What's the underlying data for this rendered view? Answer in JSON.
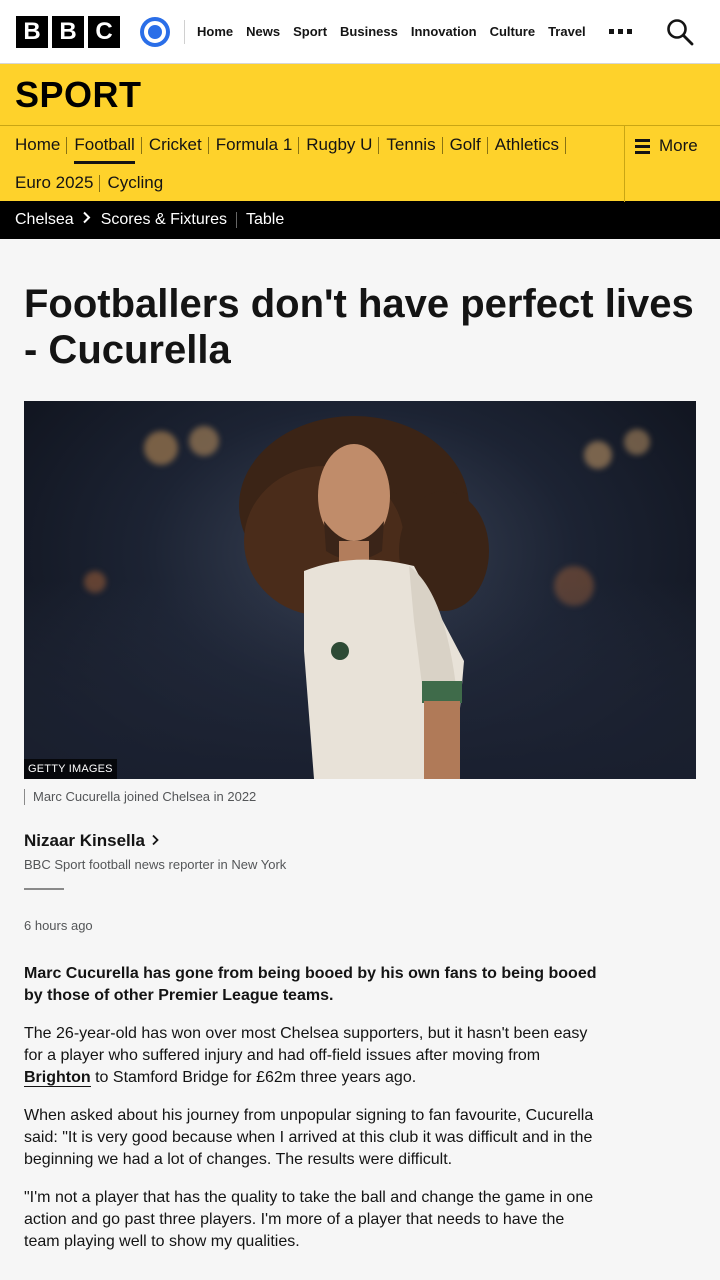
{
  "brand": {
    "letters": [
      "B",
      "B",
      "C"
    ]
  },
  "topnav": [
    "Home",
    "News",
    "Sport",
    "Business",
    "Innovation",
    "Culture",
    "Travel"
  ],
  "section": {
    "title": "SPORT"
  },
  "sportnav": {
    "row1": [
      "Home",
      "Football",
      "Cricket",
      "Formula 1",
      "Rugby U",
      "Tennis",
      "Golf",
      "Athletics"
    ],
    "row2": [
      "Euro 2025",
      "Cycling"
    ],
    "active": "Football",
    "more_label": "More"
  },
  "teambar": {
    "team": "Chelsea",
    "links": [
      "Scores & Fixtures",
      "Table"
    ]
  },
  "article": {
    "headline": "Footballers don't have perfect lives - Cucurella",
    "image_credit": "GETTY IMAGES",
    "caption": "Marc Cucurella joined Chelsea in 2022",
    "author": "Nizaar Kinsella",
    "author_role": "BBC Sport football news reporter in New York",
    "timestamp": "6 hours ago",
    "lead": "Marc Cucurella has gone from being booed by his own fans to being booed by those of other Premier League teams.",
    "p1_before": "The 26-year-old has won over most Chelsea supporters, but it hasn't been easy for a player who suffered injury and had off-field issues after moving from ",
    "p1_link": "Brighton",
    "p1_after": " to Stamford Bridge for £62m three years ago.",
    "p2": "When asked about his journey from unpopular signing to fan favourite, Cucurella said: \"It is very good because when I arrived at this club it was difficult and in the beginning we had a lot of changes. The results were difficult.",
    "p3": "\"I'm not a player that has the quality to take the ball and change the game in one action and go past three players. I'm more of a player that needs to have the team playing well to show my qualities."
  },
  "colors": {
    "sport_yellow": "#fed22b",
    "account_blue": "#2a6ee8",
    "teambar_bg": "#000000"
  },
  "icons": [
    "account-icon",
    "more-dots-icon",
    "search-icon",
    "hamburger-icon",
    "chevron-right-icon"
  ]
}
